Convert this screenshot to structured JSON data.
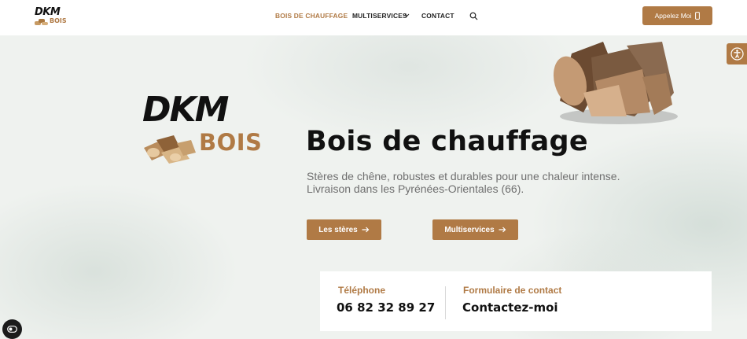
{
  "header": {
    "logo": {
      "brand": "DKM",
      "sub": "BOIS"
    },
    "nav": [
      {
        "label": "BOIS DE CHAUFFAGE",
        "active": true
      },
      {
        "label": "MULTISERVICES",
        "has_dropdown": true
      },
      {
        "label": "CONTACT"
      }
    ],
    "search_icon": "search-icon",
    "call_button": {
      "label": "Appelez Moi",
      "icon": "phone-icon"
    }
  },
  "hero": {
    "logo": {
      "brand": "DKM",
      "sub": "BOIS"
    },
    "title": "Bois de chauffage",
    "subtitle_line1": "Stères de chêne, robustes et durables pour une chaleur intense.",
    "subtitle_line2": "Livraison dans les Pyrénées-Orientales (66).",
    "buttons": [
      {
        "label": "Les stères",
        "icon": "arrow-right-icon"
      },
      {
        "label": "Multiservices",
        "icon": "arrow-right-icon"
      }
    ]
  },
  "contact_card": {
    "phone_label": "Téléphone",
    "phone_value": "06 82 32 89 27",
    "form_label": "Formulaire de contact",
    "form_value": "Contactez-moi"
  },
  "widgets": {
    "accessibility_icon": "accessibility-icon",
    "cookie_icon": "cookie-settings-icon"
  },
  "colors": {
    "accent": "#b07a45",
    "text": "#111111",
    "muted": "#6f6f6f"
  }
}
